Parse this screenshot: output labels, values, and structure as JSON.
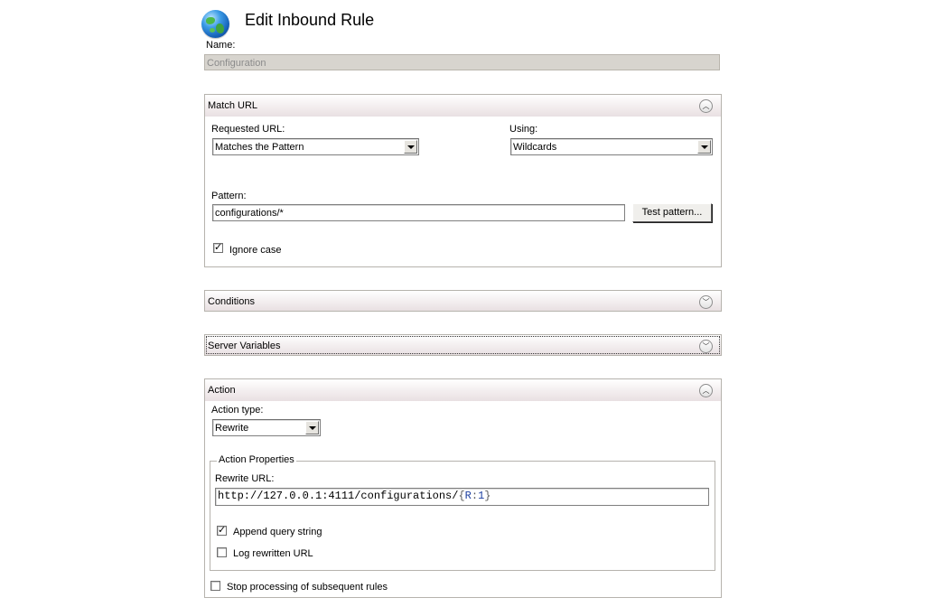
{
  "header": {
    "title": "Edit Inbound Rule",
    "icon": "globe-icon"
  },
  "name_field": {
    "label": "Name:",
    "value": "Configuration"
  },
  "match_url": {
    "title": "Match URL",
    "expanded": true,
    "requested_url_label": "Requested URL:",
    "requested_url_value": "Matches the Pattern",
    "using_label": "Using:",
    "using_value": "Wildcards",
    "pattern_label": "Pattern:",
    "pattern_value": "configurations/*",
    "test_pattern_button": "Test pattern...",
    "ignore_case_label": "Ignore case",
    "ignore_case_checked": true
  },
  "conditions": {
    "title": "Conditions",
    "expanded": false
  },
  "server_variables": {
    "title": "Server Variables",
    "expanded": false
  },
  "action": {
    "title": "Action",
    "expanded": true,
    "action_type_label": "Action type:",
    "action_type_value": "Rewrite",
    "properties_title": "Action Properties",
    "rewrite_url_label": "Rewrite URL:",
    "rewrite_url_prefix": "http://127.0.0.1:4111/configurations/",
    "rewrite_url_open": "{",
    "rewrite_url_var": "R",
    "rewrite_url_sep": ":",
    "rewrite_url_index": "1",
    "rewrite_url_close": "}",
    "append_query_label": "Append query string",
    "append_query_checked": true,
    "log_rewritten_label": "Log rewritten URL",
    "log_rewritten_checked": false,
    "stop_processing_label": "Stop processing of subsequent rules",
    "stop_processing_checked": false
  },
  "glyphs": {
    "collapse": "︿",
    "expand": "﹀",
    "check": "✓"
  },
  "colors": {
    "panel_border": "#b6b3ad",
    "header_gradient_end": "#e9e0e2",
    "name_field_bg": "#d7d4ce"
  }
}
